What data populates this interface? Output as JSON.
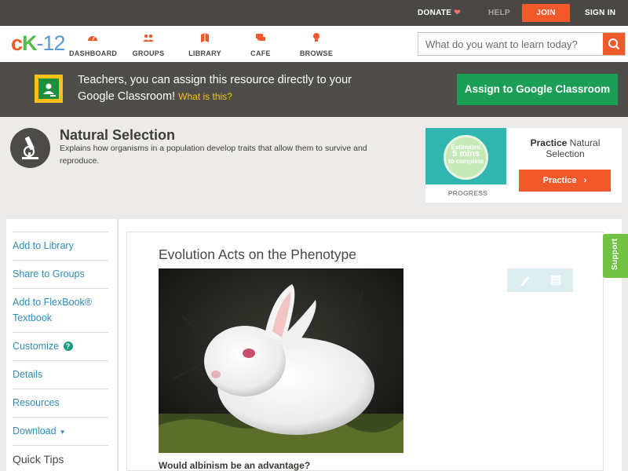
{
  "topbar": {
    "donate": "DONATE",
    "help": "HELP",
    "join": "JOIN",
    "signin": "SIGN IN"
  },
  "nav": {
    "logo_c": "c",
    "logo_k": "K",
    "logo_rest": "-12",
    "items": [
      {
        "label": "DASHBOARD",
        "icon": "dashboard-gauge-icon"
      },
      {
        "label": "GROUPS",
        "icon": "groups-people-icon"
      },
      {
        "label": "LIBRARY",
        "icon": "library-book-icon"
      },
      {
        "label": "CAFE",
        "icon": "cafe-chat-icon"
      },
      {
        "label": "BROWSE",
        "icon": "browse-lightbulb-icon"
      }
    ],
    "search_placeholder": "What do you want to learn today?"
  },
  "banner": {
    "message": "Teachers, you can assign this resource directly to your Google Classroom!",
    "what_link": "What is this?",
    "assign_button": "Assign to Google Classroom"
  },
  "concept": {
    "title": "Natural Selection",
    "description": "Explains how organisms in a population develop traits that allow them to survive and reproduce."
  },
  "practice": {
    "estimate_line1": "Estimated",
    "estimate_line2": "5 mins",
    "estimate_line3": "to complete",
    "progress_label": "PROGRESS",
    "title_bold": "Practice",
    "title_rest": "Natural Selection",
    "button": "Practice"
  },
  "sidebar": {
    "items": [
      {
        "label": "Add to Library"
      },
      {
        "label": "Share to Groups"
      },
      {
        "label": "Add to FlexBook® Textbook"
      },
      {
        "label": "Customize"
      },
      {
        "label": "Details"
      },
      {
        "label": "Resources"
      },
      {
        "label": "Download"
      }
    ],
    "customize_badge": "?",
    "download_caret": "▼",
    "quick_tips": "Quick Tips"
  },
  "article": {
    "title": "Evolution Acts on the Phenotype",
    "question": "Would albinism be an advantage?"
  },
  "support": "Support",
  "colors": {
    "accent_orange": "#f1582a",
    "classroom_green": "#1b9e55",
    "link_blue": "#2d8cb8",
    "support_green": "#74c243"
  }
}
